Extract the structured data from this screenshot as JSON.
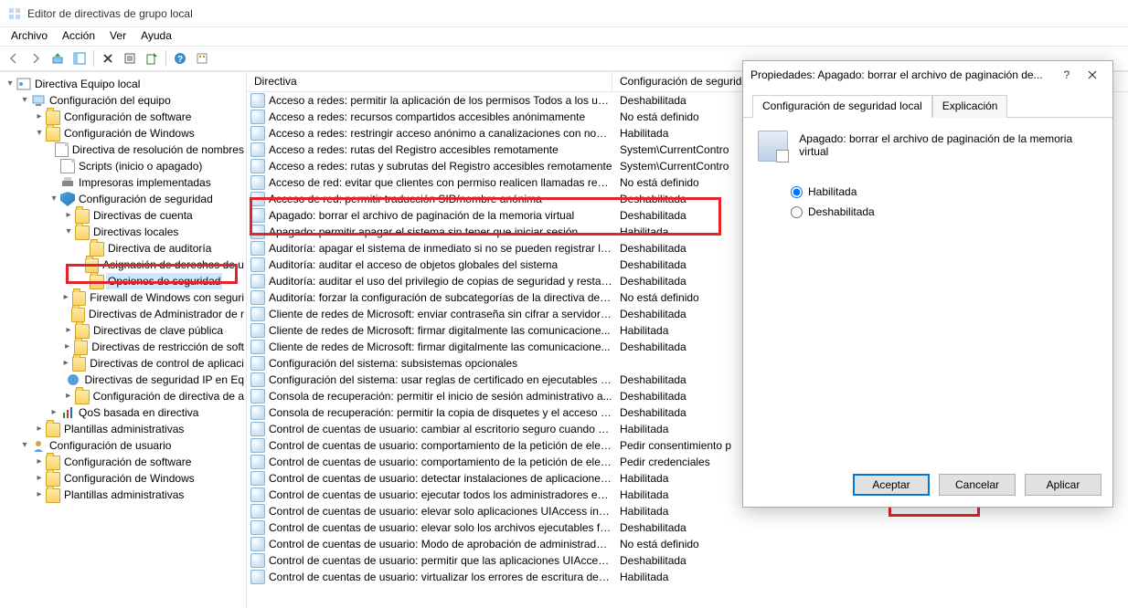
{
  "window": {
    "title": "Editor de directivas de grupo local"
  },
  "menu": {
    "file": "Archivo",
    "action": "Acción",
    "view": "Ver",
    "help": "Ayuda"
  },
  "columns": {
    "directive": "Directiva",
    "setting": "Configuración de seguridad"
  },
  "tree": {
    "root": "Directiva Equipo local",
    "computer_config": "Configuración del equipo",
    "software_config": "Configuración de software",
    "windows_config": "Configuración de Windows",
    "name_res": "Directiva de resolución de nombres",
    "scripts": "Scripts (inicio o apagado)",
    "printers": "Impresoras implementadas",
    "security_config": "Configuración de seguridad",
    "account_policies": "Directivas de cuenta",
    "local_policies": "Directivas locales",
    "audit_policy": "Directiva de auditoría",
    "user_rights": "Asignación de derechos de u",
    "security_options": "Opciones de seguridad",
    "firewall": "Firewall de Windows con seguri",
    "network_list": "Directivas de Administrador de r",
    "public_key": "Directivas de clave pública",
    "software_restriction": "Directivas de restricción de soft",
    "app_control": "Directivas de control de aplicaci",
    "ipsec": "Directivas de seguridad IP en Eq",
    "advanced_audit": "Configuración de directiva de a",
    "qos": "QoS basada en directiva",
    "admin_templates": "Plantillas administrativas",
    "user_config": "Configuración de usuario",
    "software_config_u": "Configuración de software",
    "windows_config_u": "Configuración de Windows",
    "admin_templates_u": "Plantillas administrativas"
  },
  "policies": [
    {
      "name": "Acceso a redes: permitir la aplicación de los permisos Todos a los usu...",
      "value": "Deshabilitada"
    },
    {
      "name": "Acceso a redes: recursos compartidos accesibles anónimamente",
      "value": "No está definido"
    },
    {
      "name": "Acceso a redes: restringir acceso anónimo a canalizaciones con nomb...",
      "value": "Habilitada"
    },
    {
      "name": "Acceso a redes: rutas del Registro accesibles remotamente",
      "value": "System\\CurrentContro"
    },
    {
      "name": "Acceso a redes: rutas y subrutas del Registro accesibles remotamente",
      "value": "System\\CurrentContro"
    },
    {
      "name": "Acceso de red: evitar que clientes con permiso realicen llamadas rem...",
      "value": "No está definido"
    },
    {
      "name": "Acceso de red: permitir traducción SID/nombre anónima",
      "value": "Deshabilitada"
    },
    {
      "name": "Apagado: borrar el archivo de paginación de la memoria virtual",
      "value": "Deshabilitada"
    },
    {
      "name": "Apagado: permitir apagar el sistema sin tener que iniciar sesión",
      "value": "Habilitada"
    },
    {
      "name": "Auditoría: apagar el sistema de inmediato si no se pueden registrar las...",
      "value": "Deshabilitada"
    },
    {
      "name": "Auditoría: auditar el acceso de objetos globales del sistema",
      "value": "Deshabilitada"
    },
    {
      "name": "Auditoría: auditar el uso del privilegio de copias de seguridad y restau...",
      "value": "Deshabilitada"
    },
    {
      "name": "Auditoría: forzar la configuración de subcategorías de la directiva de a...",
      "value": "No está definido"
    },
    {
      "name": "Cliente de redes de Microsoft: enviar contraseña sin cifrar a servidores...",
      "value": "Deshabilitada"
    },
    {
      "name": "Cliente de redes de Microsoft: firmar digitalmente las comunicacione...",
      "value": "Habilitada"
    },
    {
      "name": "Cliente de redes de Microsoft: firmar digitalmente las comunicacione...",
      "value": "Deshabilitada"
    },
    {
      "name": "Configuración del sistema: subsistemas opcionales",
      "value": ""
    },
    {
      "name": "Configuración del sistema: usar reglas de certificado en ejecutables d...",
      "value": "Deshabilitada"
    },
    {
      "name": "Consola de recuperación: permitir el inicio de sesión administrativo a...",
      "value": "Deshabilitada"
    },
    {
      "name": "Consola de recuperación: permitir la copia de disquetes y el acceso a t...",
      "value": "Deshabilitada"
    },
    {
      "name": "Control de cuentas de usuario: cambiar al escritorio seguro cuando se...",
      "value": "Habilitada"
    },
    {
      "name": "Control de cuentas de usuario: comportamiento de la petición de elev...",
      "value": "Pedir consentimiento p"
    },
    {
      "name": "Control de cuentas de usuario: comportamiento de la petición de elev...",
      "value": "Pedir credenciales"
    },
    {
      "name": "Control de cuentas de usuario: detectar instalaciones de aplicaciones ...",
      "value": "Habilitada"
    },
    {
      "name": "Control de cuentas de usuario: ejecutar todos los administradores en ...",
      "value": "Habilitada"
    },
    {
      "name": "Control de cuentas de usuario: elevar solo aplicaciones UIAccess insta...",
      "value": "Habilitada"
    },
    {
      "name": "Control de cuentas de usuario: elevar solo los archivos ejecutables fir...",
      "value": "Deshabilitada"
    },
    {
      "name": "Control de cuentas de usuario: Modo de aprobación de administrador...",
      "value": "No está definido"
    },
    {
      "name": "Control de cuentas de usuario: permitir que las aplicaciones UIAccess ...",
      "value": "Deshabilitada"
    },
    {
      "name": "Control de cuentas de usuario: virtualizar los errores de escritura de a...",
      "value": "Habilitada"
    }
  ],
  "dialog": {
    "title": "Propiedades: Apagado: borrar el archivo de paginación de...",
    "tab1": "Configuración de seguridad local",
    "tab2": "Explicación",
    "policy_name": "Apagado: borrar el archivo de paginación de la memoria virtual",
    "enabled": "Habilitada",
    "disabled": "Deshabilitada",
    "accept": "Aceptar",
    "cancel": "Cancelar",
    "apply": "Aplicar"
  }
}
